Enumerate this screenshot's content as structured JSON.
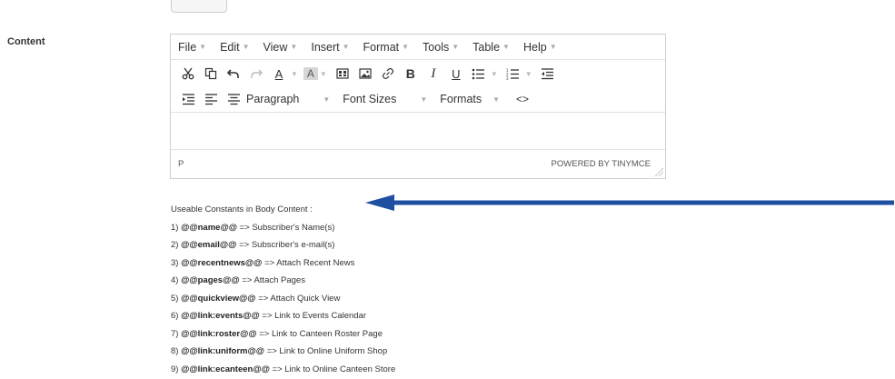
{
  "field": {
    "label": "Content"
  },
  "editor": {
    "menu": [
      "File",
      "Edit",
      "View",
      "Insert",
      "Format",
      "Tools",
      "Table",
      "Help"
    ],
    "toolbar": {
      "paragraph_label": "Paragraph",
      "font_sizes_label": "Font Sizes",
      "formats_label": "Formats",
      "code_label": "<>"
    },
    "status": {
      "path": "P",
      "powered_by": "POWERED BY TINYMCE"
    }
  },
  "constants": {
    "heading": "Useable Constants in Body Content :",
    "items": [
      {
        "num": "1)",
        "token": "@@name@@",
        "desc": "=> Subscriber's Name(s)"
      },
      {
        "num": "2)",
        "token": "@@email@@",
        "desc": "=> Subscriber's e-mail(s)"
      },
      {
        "num": "3)",
        "token": "@@recentnews@@",
        "desc": "=> Attach Recent News"
      },
      {
        "num": "4)",
        "token": "@@pages@@",
        "desc": "=> Attach Pages"
      },
      {
        "num": "5)",
        "token": "@@quickview@@",
        "desc": "=> Attach Quick View"
      },
      {
        "num": "6)",
        "token": "@@link:events@@",
        "desc": "=> Link to Events Calendar"
      },
      {
        "num": "7)",
        "token": "@@link:roster@@",
        "desc": "=> Link to Canteen Roster Page"
      },
      {
        "num": "8)",
        "token": "@@link:uniform@@",
        "desc": "=> Link to Online Uniform Shop"
      },
      {
        "num": "9)",
        "token": "@@link:ecanteen@@",
        "desc": "=> Link to Online Canteen Store"
      }
    ]
  },
  "colors": {
    "arrow": "#1f4fa0",
    "border": "#cfcfcf"
  }
}
